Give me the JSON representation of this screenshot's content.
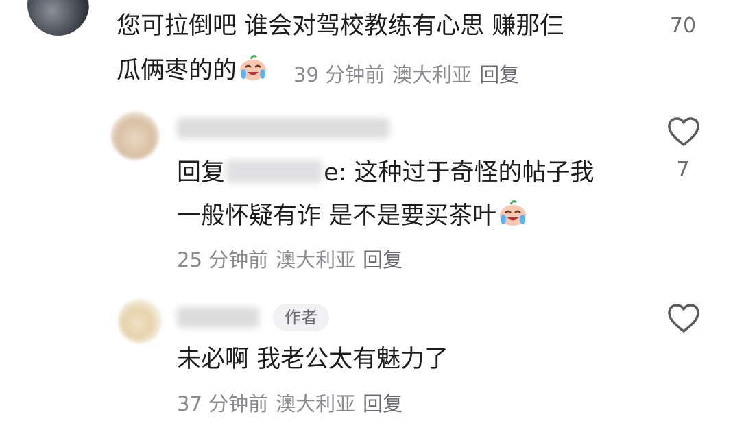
{
  "comments": [
    {
      "text_line1": "您可拉倒吧 谁会对驾校教练有心思 赚那仨",
      "text_line2": "瓜俩枣的的",
      "emoji": "crying-laughing-emoji",
      "time": "39 分钟前",
      "location": "澳大利亚",
      "reply_label": "回复",
      "like_count": "70"
    },
    {
      "username_blurred": "…后凉流瓶软茶吧",
      "reply_prefix": "回复",
      "reply_suffix": "e: 这种过于奇怪的帖子我",
      "text_line2": "一般怀疑有诈 是不是要买茶叶",
      "emoji": "crying-laughing-emoji",
      "time": "25 分钟前",
      "location": "澳大利亚",
      "reply_label": "回复",
      "like_count": "7"
    },
    {
      "username_blurred": "…教RR",
      "author_badge": "作者",
      "text_line1": "未必啊 我老公太有魅力了",
      "time": "37 分钟前",
      "location": "澳大利亚",
      "reply_label": "回复"
    }
  ],
  "icons": {
    "like": "heart-outline-icon"
  },
  "colors": {
    "text": "#1d1d1f",
    "meta": "#8a8a8f",
    "badge_bg": "#f1f1f3"
  }
}
